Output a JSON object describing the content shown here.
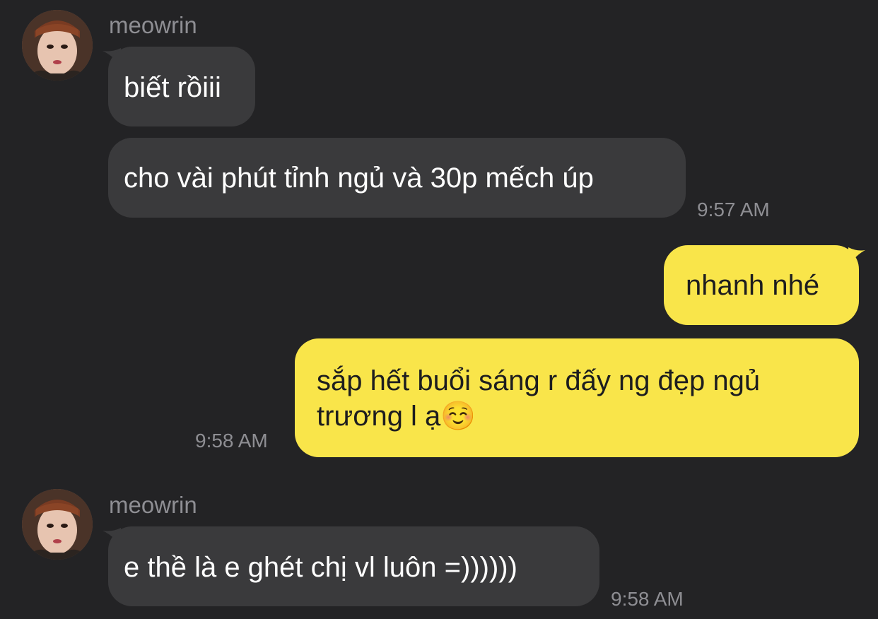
{
  "theme": {
    "background": "#232325",
    "incoming_bubble": "#3a3a3c",
    "outgoing_bubble": "#f9e54a",
    "meta_text": "#8e8e93"
  },
  "messages": [
    {
      "direction": "incoming",
      "sender": "meowrin",
      "avatar": "profile-photo",
      "text": "biết rồiii"
    },
    {
      "direction": "incoming",
      "text": "cho vài phút tỉnh ngủ và 30p mếch úp",
      "time": "9:57 AM"
    },
    {
      "direction": "outgoing",
      "text": "nhanh nhé"
    },
    {
      "direction": "outgoing",
      "text_lines": [
        "sắp hết buổi sáng r đấy ng đẹp ngủ",
        "trương l ạ☺️"
      ],
      "time": "9:58 AM"
    },
    {
      "direction": "incoming",
      "sender": "meowrin",
      "avatar": "profile-photo",
      "text": "e thề là e ghét chị vl luôn =))))))",
      "time": "9:58 AM"
    }
  ]
}
